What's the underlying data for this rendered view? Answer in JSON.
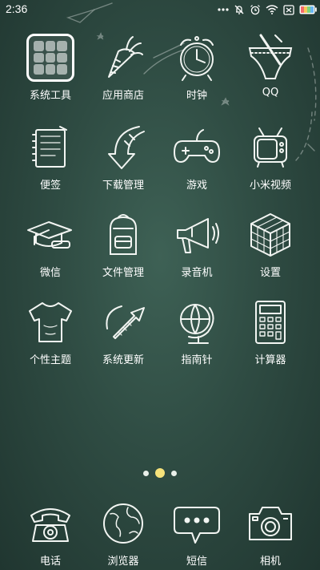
{
  "status_bar": {
    "time": "2:36",
    "icons": [
      "more-dots-icon",
      "notifications-muted-icon",
      "alarm-icon",
      "wifi-icon",
      "sim-icon",
      "battery-icon"
    ]
  },
  "apps": [
    {
      "label": "系统工具",
      "icon": "tools-folder-icon"
    },
    {
      "label": "应用商店",
      "icon": "carrot-store-icon"
    },
    {
      "label": "时钟",
      "icon": "alarm-clock-icon"
    },
    {
      "label": "QQ",
      "icon": "qq-briefs-icon"
    },
    {
      "label": "便签",
      "icon": "notepad-icon"
    },
    {
      "label": "下载管理",
      "icon": "download-arrow-icon"
    },
    {
      "label": "游戏",
      "icon": "gamepad-icon"
    },
    {
      "label": "小米视频",
      "icon": "tv-icon"
    },
    {
      "label": "微信",
      "icon": "graduation-cap-icon"
    },
    {
      "label": "文件管理",
      "icon": "backpack-icon"
    },
    {
      "label": "录音机",
      "icon": "megaphone-icon"
    },
    {
      "label": "设置",
      "icon": "rubiks-cube-icon"
    },
    {
      "label": "个性主题",
      "icon": "tshirt-icon"
    },
    {
      "label": "系统更新",
      "icon": "update-arrow-icon"
    },
    {
      "label": "指南针",
      "icon": "globe-compass-icon"
    },
    {
      "label": "计算器",
      "icon": "calculator-icon"
    }
  ],
  "pager": {
    "pages": 3,
    "current": 2
  },
  "dock": [
    {
      "label": "电话",
      "icon": "rotary-phone-icon"
    },
    {
      "label": "浏览器",
      "icon": "globe-browser-icon"
    },
    {
      "label": "短信",
      "icon": "chat-bubble-icon"
    },
    {
      "label": "相机",
      "icon": "camera-icon"
    }
  ],
  "colors": {
    "background": "#2f4c43",
    "chalk": "#f2f5f2",
    "active_dot": "#f6e27a"
  }
}
